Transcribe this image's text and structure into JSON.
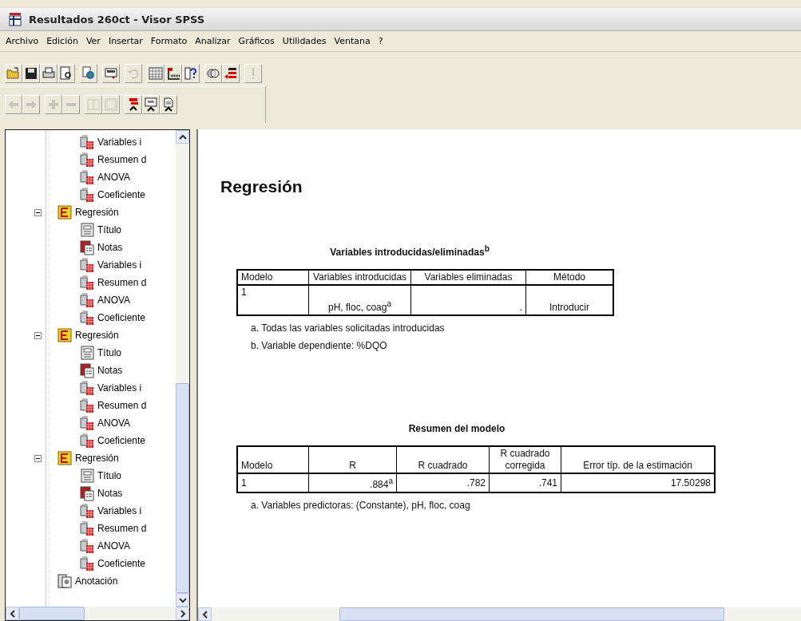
{
  "window": {
    "title": "Resultados 260ct - Visor SPSS"
  },
  "menu": [
    "Archivo",
    "Edición",
    "Ver",
    "Insertar",
    "Formato",
    "Analizar",
    "Gráficos",
    "Utilidades",
    "Ventana",
    "?"
  ],
  "toolbar": [
    [
      {
        "kind": "open",
        "disabled": false
      },
      {
        "kind": "save",
        "disabled": false
      },
      {
        "kind": "print",
        "disabled": false
      },
      {
        "kind": "preview",
        "disabled": false
      }
    ],
    [
      {
        "kind": "data",
        "disabled": false
      }
    ],
    [
      {
        "kind": "dialog",
        "disabled": false
      }
    ],
    [
      {
        "kind": "undo",
        "disabled": true
      }
    ],
    [
      {
        "kind": "grid",
        "disabled": false
      },
      {
        "kind": "variables",
        "disabled": false
      },
      {
        "kind": "info",
        "disabled": false
      }
    ],
    [
      {
        "kind": "sets",
        "disabled": false
      },
      {
        "kind": "script",
        "disabled": false
      }
    ],
    [
      {
        "kind": "run",
        "disabled": true
      }
    ]
  ],
  "nav_toolbar": [
    [
      {
        "kind": "back",
        "disabled": true
      },
      {
        "kind": "forward",
        "disabled": true
      }
    ],
    [
      {
        "kind": "expand",
        "disabled": true
      },
      {
        "kind": "collapse",
        "disabled": true
      }
    ],
    [
      {
        "kind": "show",
        "disabled": true
      },
      {
        "kind": "hide",
        "disabled": true
      }
    ],
    [
      {
        "kind": "heading",
        "disabled": false
      },
      {
        "kind": "title",
        "disabled": false
      },
      {
        "kind": "text",
        "disabled": false
      }
    ]
  ],
  "outline": [
    {
      "children": [
        {
          "kind": "table",
          "label": "Variables i"
        },
        {
          "kind": "table",
          "label": "Resumen d"
        },
        {
          "kind": "table",
          "label": "ANOVA"
        },
        {
          "kind": "table",
          "label": "Coeficiente"
        }
      ]
    },
    {
      "kind": "heading",
      "label": "Regresión",
      "expanded": true,
      "children": [
        {
          "kind": "title",
          "label": "Título"
        },
        {
          "kind": "notes",
          "label": "Notas"
        },
        {
          "kind": "table",
          "label": "Variables i"
        },
        {
          "kind": "table",
          "label": "Resumen d"
        },
        {
          "kind": "table",
          "label": "ANOVA"
        },
        {
          "kind": "table",
          "label": "Coeficiente"
        }
      ]
    },
    {
      "kind": "heading",
      "label": "Regresión",
      "expanded": true,
      "children": [
        {
          "kind": "title",
          "label": "Título"
        },
        {
          "kind": "notes",
          "label": "Notas"
        },
        {
          "kind": "table",
          "label": "Variables i"
        },
        {
          "kind": "table",
          "label": "Resumen d"
        },
        {
          "kind": "table",
          "label": "ANOVA"
        },
        {
          "kind": "table",
          "label": "Coeficiente"
        }
      ]
    },
    {
      "kind": "heading",
      "label": "Regresión",
      "expanded": true,
      "children": [
        {
          "kind": "title",
          "label": "Título"
        },
        {
          "kind": "notes",
          "label": "Notas"
        },
        {
          "kind": "table",
          "label": "Variables i"
        },
        {
          "kind": "table",
          "label": "Resumen d"
        },
        {
          "kind": "table",
          "label": "ANOVA"
        },
        {
          "kind": "table",
          "label": "Coeficiente"
        }
      ]
    },
    {
      "kind": "annotation",
      "label": "Anotación"
    }
  ],
  "content": {
    "heading": "Regresión",
    "tables": [
      {
        "title": "Variables introducidas/eliminadas$^{b}$",
        "columns": [
          "Modelo",
          "Variables introducidas",
          "Variables eliminadas",
          "Método"
        ],
        "rows": [
          [
            "1",
            "pH, floc, coag$^{a}$",
            ".",
            "Introducir"
          ]
        ],
        "footnotes": [
          "a. Todas las variables solicitadas introducidas",
          "b. Variable dependiente: %DQO"
        ]
      },
      {
        "title": "Resumen del modelo",
        "columns": [
          "Modelo",
          "R",
          "R cuadrado",
          "R cuadrado corregida",
          "Error típ. de la estimación"
        ],
        "rows": [
          [
            "1",
            ".884$^{a}$",
            ".782",
            ".741",
            "17.50298"
          ]
        ],
        "footnotes": [
          "a. Variables predictoras: (Constante), pH, floc, coag"
        ]
      }
    ]
  }
}
